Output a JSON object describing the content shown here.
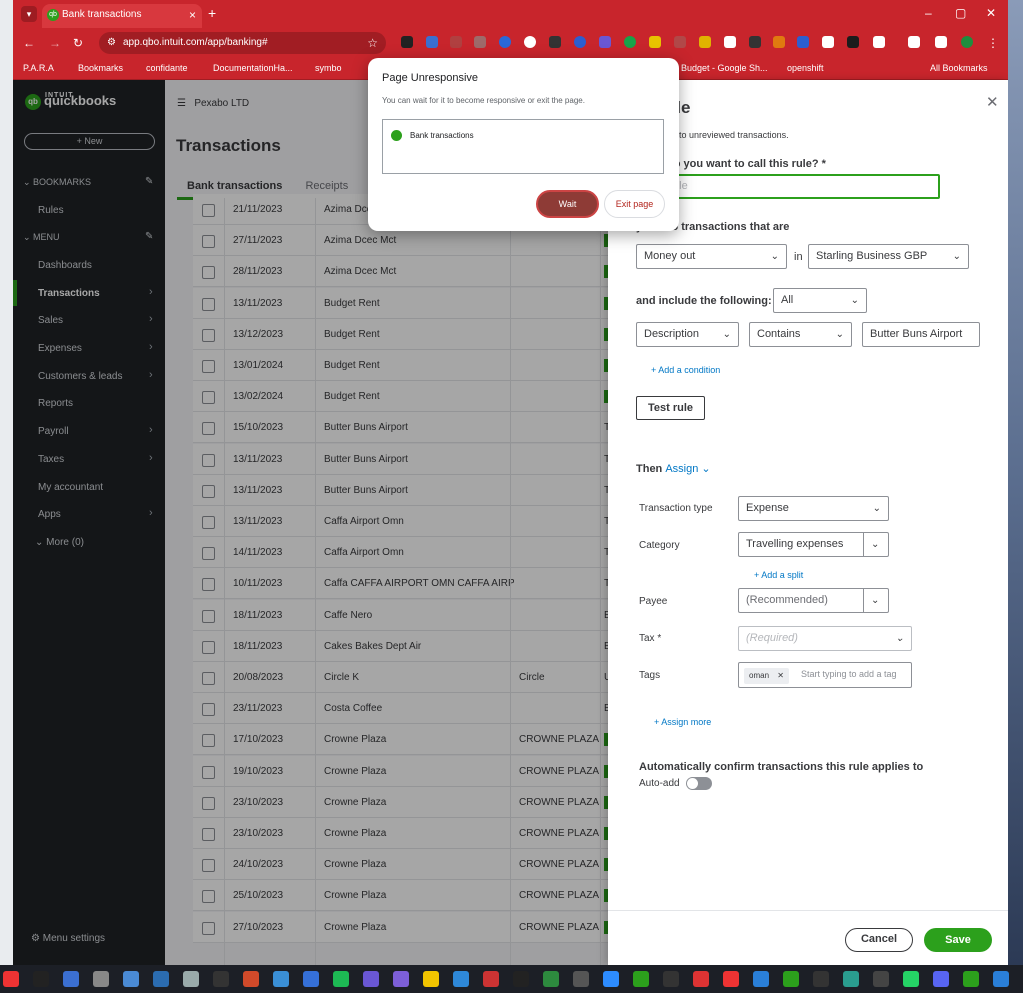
{
  "browser": {
    "tab_title": "Bank transactions",
    "url": "app.qbo.intuit.com/app/banking#",
    "bookmarks": [
      "P.A.R.A",
      "Bookmarks",
      "confidante",
      "DocumentationHa...",
      "symbo",
      "Budget - Google Sh...",
      "openshift",
      "All Bookmarks"
    ]
  },
  "sidebar": {
    "logo_top": "INTUIT",
    "logo_brand": "quickbooks",
    "new_label": "+ New",
    "bookmarks_header": "BOOKMARKS",
    "bookmark_items": [
      "Rules"
    ],
    "menu_header": "MENU",
    "menu_items": [
      "Dashboards",
      "Transactions",
      "Sales",
      "Expenses",
      "Customers & leads",
      "Reports",
      "Payroll",
      "Taxes",
      "My accountant",
      "Apps"
    ],
    "more": "More (0)",
    "settings": "Menu settings"
  },
  "main": {
    "company": "Pexabo LTD",
    "title": "Transactions",
    "tabs": [
      "Bank transactions",
      "Receipts"
    ],
    "rows": [
      {
        "date": "21/11/2023",
        "desc": "Azima Dcec Mct",
        "payee": "",
        "gl": ""
      },
      {
        "date": "27/11/2023",
        "desc": "Azima Dcec Mct",
        "payee": "",
        "gl": ""
      },
      {
        "date": "28/11/2023",
        "desc": "Azima Dcec Mct",
        "payee": "",
        "gl": ""
      },
      {
        "date": "13/11/2023",
        "desc": "Budget Rent",
        "payee": "",
        "gl": ""
      },
      {
        "date": "13/12/2023",
        "desc": "Budget Rent",
        "payee": "",
        "gl": ""
      },
      {
        "date": "13/01/2024",
        "desc": "Budget Rent",
        "payee": "",
        "gl": ""
      },
      {
        "date": "13/02/2024",
        "desc": "Budget Rent",
        "payee": "",
        "gl": ""
      },
      {
        "date": "15/10/2023",
        "desc": "Butter Buns Airport",
        "payee": "",
        "gl": "T"
      },
      {
        "date": "13/11/2023",
        "desc": "Butter Buns Airport",
        "payee": "",
        "gl": "T"
      },
      {
        "date": "13/11/2023",
        "desc": "Butter Buns Airport",
        "payee": "",
        "gl": "T"
      },
      {
        "date": "13/11/2023",
        "desc": "Caffa Airport Omn",
        "payee": "",
        "gl": "T"
      },
      {
        "date": "14/11/2023",
        "desc": "Caffa Airport Omn",
        "payee": "",
        "gl": "T"
      },
      {
        "date": "10/11/2023",
        "desc": "Caffa CAFFA AIRPORT OMN CAFFA AIRPC",
        "payee": "",
        "gl": "T"
      },
      {
        "date": "18/11/2023",
        "desc": "Caffe Nero",
        "payee": "",
        "gl": "E"
      },
      {
        "date": "18/11/2023",
        "desc": "Cakes Bakes Dept Air",
        "payee": "",
        "gl": "E"
      },
      {
        "date": "20/08/2023",
        "desc": "Circle K",
        "payee": "Circle",
        "gl": "U"
      },
      {
        "date": "23/11/2023",
        "desc": "Costa Coffee",
        "payee": "",
        "gl": "E"
      },
      {
        "date": "17/10/2023",
        "desc": "Crowne Plaza",
        "payee": "CROWNE PLAZA",
        "gl": ""
      },
      {
        "date": "19/10/2023",
        "desc": "Crowne Plaza",
        "payee": "CROWNE PLAZA",
        "gl": ""
      },
      {
        "date": "23/10/2023",
        "desc": "Crowne Plaza",
        "payee": "CROWNE PLAZA",
        "gl": ""
      },
      {
        "date": "23/10/2023",
        "desc": "Crowne Plaza",
        "payee": "CROWNE PLAZA",
        "gl": ""
      },
      {
        "date": "24/10/2023",
        "desc": "Crowne Plaza",
        "payee": "CROWNE PLAZA",
        "gl": ""
      },
      {
        "date": "25/10/2023",
        "desc": "Crowne Plaza",
        "payee": "CROWNE PLAZA",
        "gl": ""
      },
      {
        "date": "27/10/2023",
        "desc": "Crowne Plaza",
        "payee": "CROWNE PLAZA",
        "gl": ""
      }
    ]
  },
  "rule": {
    "title": "ate rule",
    "subtitle": "only apply to unreviewed transactions.",
    "name_label": "do you want to call this rule? *",
    "name_placeholder": "e this rule",
    "apply_label": "y this to transactions that are",
    "direction": "Money out",
    "in_word": "in",
    "account": "Starling Business GBP",
    "include_label": "and include the following:",
    "include_value": "All",
    "cond_field": "Description",
    "cond_op": "Contains",
    "cond_value": "Butter Buns Airport",
    "add_condition": "+ Add a condition",
    "test_rule": "Test rule",
    "then": "Then",
    "assign": "Assign",
    "tx_type_label": "Transaction type",
    "tx_type": "Expense",
    "category_label": "Category",
    "category": "Travelling expenses",
    "add_split": "+ Add a split",
    "payee_label": "Payee",
    "payee": "(Recommended)",
    "tax_label": "Tax *",
    "tax": "(Required)",
    "tags_label": "Tags",
    "tag_chip": "oman",
    "tag_placeholder": "Start typing to add a tag",
    "assign_more": "+ Assign more",
    "auto_label": "Automatically confirm transactions this rule applies to",
    "auto_add": "Auto-add",
    "cancel": "Cancel",
    "save": "Save"
  },
  "dialog": {
    "title": "Page Unresponsive",
    "message": "You can wait for it to become responsive or exit the page.",
    "item": "Bank transactions",
    "wait": "Wait",
    "exit": "Exit page"
  }
}
